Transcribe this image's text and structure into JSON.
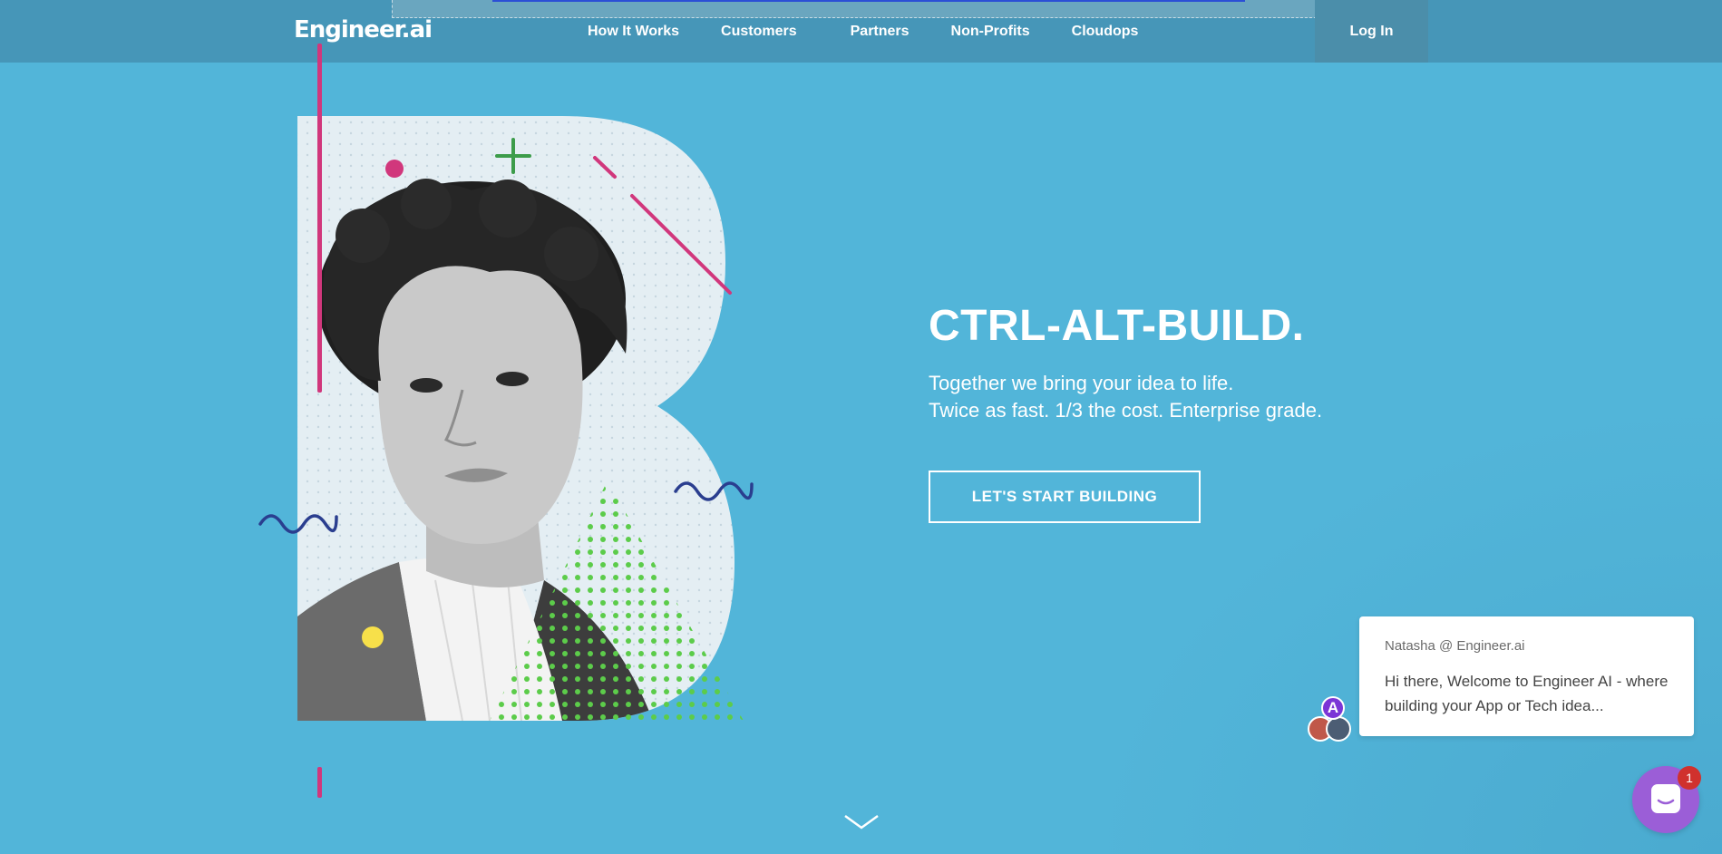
{
  "header": {
    "logo": "Engineer.ai",
    "nav": [
      {
        "label": "How It Works"
      },
      {
        "label": "Customers"
      },
      {
        "label": "Partners"
      },
      {
        "label": "Non-Profits"
      },
      {
        "label": "Cloudops"
      }
    ],
    "login_label": "Log In"
  },
  "hero": {
    "title": "CTRL-ALT-BUILD.",
    "line1": "Together we bring your idea to life.",
    "line2": "Twice as fast. 1/3 the cost. Enterprise grade.",
    "cta_label": "LET'S START BUILDING"
  },
  "chat": {
    "from": "Natasha @ Engineer.ai",
    "message": "Hi there,  Welcome to Engineer AI - where building your App or Tech idea...",
    "avatar_letter": "A",
    "unread_count": "1"
  },
  "icons": {
    "scroll": "chevron-down-icon",
    "chat": "chat-icon"
  },
  "colors": {
    "background": "#52b5d9",
    "header": "#4696b8",
    "accent_pink": "#d1377c",
    "accent_green": "#5ccc4a",
    "launcher": "#9b5ed7"
  }
}
